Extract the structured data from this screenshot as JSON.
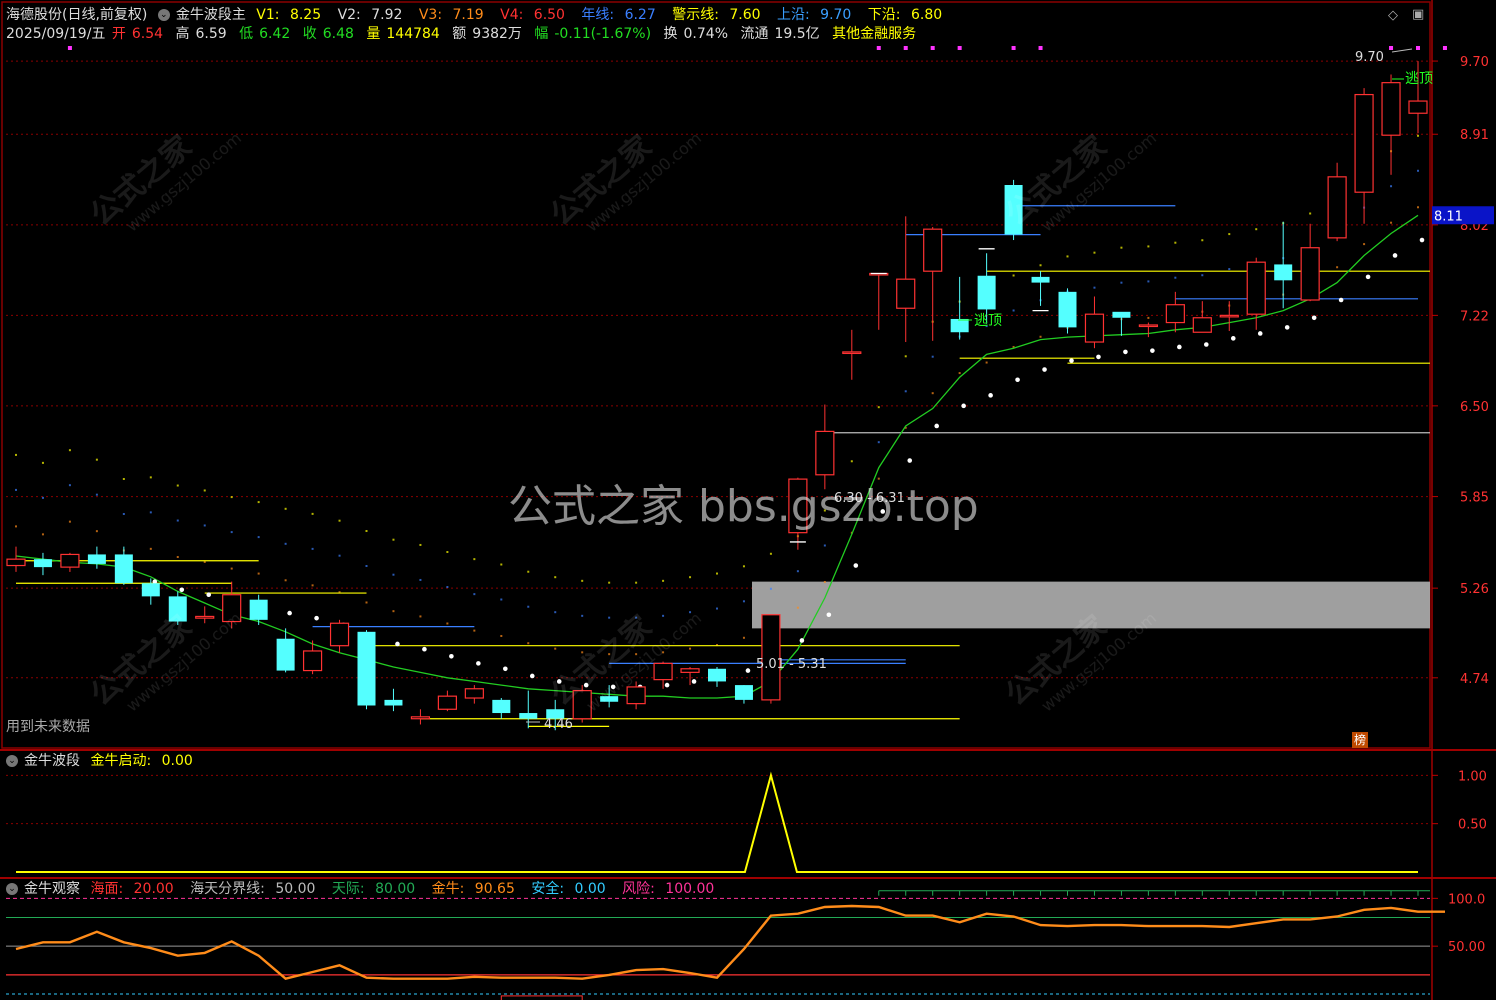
{
  "header": {
    "stock": "海德股份(日线,前复权)",
    "indicator": "金牛波段主",
    "v1_label": "V1:",
    "v1": "8.25",
    "v2_label": "V2:",
    "v2": "7.92",
    "v3_label": "V3:",
    "v3": "7.19",
    "v4_label": "V4:",
    "v4": "6.50",
    "nianxian_label": "年线:",
    "nianxian": "6.27",
    "jingshi_label": "警示线:",
    "jingshi": "7.60",
    "shangyan_label": "上沿:",
    "shangyan": "9.70",
    "xiayan_label": "下沿:",
    "xiayan": "6.80",
    "date": "2025/09/19/五",
    "open_label": "开",
    "open": "6.54",
    "high_label": "高",
    "high": "6.59",
    "low_label": "低",
    "low": "6.42",
    "close_label": "收",
    "close": "6.48",
    "vol_label": "量",
    "vol": "144784",
    "amt_label": "额",
    "amt": "9382万",
    "chg_label": "幅",
    "chg": "-0.11(-1.67%)",
    "turn_label": "换",
    "turn": "0.74%",
    "float_label": "流通",
    "float": "19.5亿",
    "sector": "其他金融服务"
  },
  "labels": {
    "future_data": "用到未来数据",
    "rank_badge": "榜",
    "watermark_center": "公式之家 bbs.gszb.top",
    "watermark_cn": "公式之家",
    "watermark_url": "www.gszj100.com",
    "escape_top": "逃顶",
    "price_mark_top": "9.70",
    "range_upper": "6.30 - 6.31",
    "range_lower": "5.01 - 5.31",
    "low_mark": "4.46",
    "current_price_tag": "8.11"
  },
  "panel2": {
    "title": "金牛波段",
    "item_label": "金牛启动:",
    "item_value": "0.00"
  },
  "panel3": {
    "title": "金牛观察",
    "haimian_label": "海面:",
    "haimian": "20.00",
    "fenjie_label": "海天分界线:",
    "fenjie": "50.00",
    "tianji_label": "天际:",
    "tianji": "80.00",
    "jinniu_label": "金牛:",
    "jinniu": "90.65",
    "anquan_label": "安全:",
    "anquan": "0.00",
    "fengxian_label": "风险:",
    "fengxian": "100.00"
  },
  "colors": {
    "up": "#ff3232",
    "down": "#54ffff",
    "ma": "#22cc22",
    "yellow": "#ffff00",
    "blue": "#3a7fff",
    "orange": "#ff8c1a",
    "magenta": "#ff33ff",
    "grid": "#8b0000"
  },
  "chart_data": [
    {
      "type": "candlestick",
      "price_axis_ticks": [
        9.7,
        8.91,
        8.02,
        7.22,
        6.5,
        5.85,
        5.26,
        4.74
      ],
      "candles": [
        [
          5.4,
          5.52,
          5.36,
          5.44
        ],
        [
          5.44,
          5.48,
          5.34,
          5.39
        ],
        [
          5.39,
          5.48,
          5.36,
          5.47
        ],
        [
          5.47,
          5.52,
          5.38,
          5.41
        ],
        [
          5.47,
          5.52,
          5.28,
          5.29
        ],
        [
          5.29,
          5.32,
          5.16,
          5.21
        ],
        [
          5.21,
          5.24,
          5.04,
          5.06
        ],
        [
          5.08,
          5.15,
          5.05,
          5.09
        ],
        [
          5.06,
          5.3,
          5.02,
          5.22
        ],
        [
          5.19,
          5.22,
          5.04,
          5.07
        ],
        [
          4.96,
          5.02,
          4.77,
          4.78
        ],
        [
          4.78,
          4.95,
          4.76,
          4.89
        ],
        [
          4.92,
          5.07,
          4.88,
          5.05
        ],
        [
          5.0,
          5.01,
          4.57,
          4.59
        ],
        [
          4.62,
          4.68,
          4.56,
          4.59
        ],
        [
          4.52,
          4.57,
          4.49,
          4.53
        ],
        [
          4.57,
          4.67,
          4.56,
          4.64
        ],
        [
          4.63,
          4.7,
          4.6,
          4.68
        ],
        [
          4.62,
          4.63,
          4.52,
          4.55
        ],
        [
          4.55,
          4.67,
          4.47,
          4.52
        ],
        [
          4.57,
          4.62,
          4.46,
          4.52
        ],
        [
          4.52,
          4.7,
          4.5,
          4.67
        ],
        [
          4.64,
          4.7,
          4.58,
          4.61
        ],
        [
          4.6,
          4.72,
          4.57,
          4.69
        ],
        [
          4.73,
          4.83,
          4.68,
          4.82
        ],
        [
          4.77,
          4.8,
          4.7,
          4.79
        ],
        [
          4.79,
          4.8,
          4.69,
          4.72
        ],
        [
          4.7,
          4.7,
          4.6,
          4.62
        ],
        [
          4.62,
          5.1,
          4.6,
          5.1
        ],
        [
          5.61,
          5.98,
          5.5,
          5.97
        ],
        [
          6.0,
          6.51,
          5.9,
          6.31
        ],
        [
          6.92,
          7.1,
          6.7,
          6.92
        ],
        [
          7.58,
          7.58,
          7.1,
          7.58
        ],
        [
          7.28,
          8.1,
          7.0,
          7.53
        ],
        [
          7.6,
          8.0,
          7.01,
          7.98
        ],
        [
          7.19,
          7.55,
          7.02,
          7.08
        ],
        [
          7.56,
          7.76,
          7.15,
          7.27
        ],
        [
          8.4,
          8.45,
          7.88,
          7.93
        ],
        [
          7.55,
          7.6,
          7.3,
          7.5
        ],
        [
          7.42,
          7.45,
          7.07,
          7.12
        ],
        [
          7.0,
          7.38,
          6.95,
          7.23
        ],
        [
          7.25,
          7.22,
          7.05,
          7.2
        ],
        [
          7.14,
          7.16,
          7.04,
          7.14
        ],
        [
          7.16,
          7.42,
          7.08,
          7.31
        ],
        [
          7.08,
          7.34,
          7.08,
          7.2
        ],
        [
          7.21,
          7.34,
          7.09,
          7.22
        ],
        [
          7.23,
          7.72,
          7.1,
          7.68
        ],
        [
          7.66,
          8.05,
          7.28,
          7.52
        ],
        [
          7.35,
          8.03,
          7.34,
          7.81
        ],
        [
          7.9,
          8.62,
          7.87,
          8.48
        ],
        [
          8.33,
          9.4,
          8.03,
          9.33
        ],
        [
          8.9,
          9.55,
          8.5,
          9.46
        ],
        [
          9.13,
          9.7,
          8.92,
          9.26
        ]
      ],
      "ma": [
        5.46,
        5.44,
        5.42,
        5.41,
        5.39,
        5.33,
        5.24,
        5.17,
        5.1,
        5.06,
        5.0,
        4.93,
        4.88,
        4.84,
        4.8,
        4.77,
        4.74,
        4.72,
        4.7,
        4.68,
        4.67,
        4.66,
        4.65,
        4.64,
        4.64,
        4.63,
        4.63,
        4.64,
        4.72,
        4.9,
        5.2,
        5.6,
        6.05,
        6.35,
        6.48,
        6.72,
        6.9,
        6.95,
        7.02,
        7.04,
        7.05,
        7.06,
        7.07,
        7.1,
        7.12,
        7.16,
        7.2,
        7.26,
        7.36,
        7.5,
        7.74,
        7.94,
        8.11
      ],
      "white_dots": [
        null,
        null,
        null,
        null,
        null,
        5.3,
        5.25,
        5.22,
        5.18,
        5.15,
        5.11,
        5.08,
        5.04,
        4.98,
        4.93,
        4.9,
        4.86,
        4.82,
        4.79,
        4.75,
        4.72,
        4.7,
        4.69,
        4.69,
        4.7,
        4.72,
        4.74,
        4.78,
        4.85,
        4.95,
        5.1,
        5.4,
        5.75,
        6.1,
        6.35,
        6.5,
        6.58,
        6.7,
        6.78,
        6.85,
        6.88,
        6.92,
        6.93,
        6.96,
        6.98,
        7.03,
        7.07,
        7.12,
        7.2,
        7.35,
        7.55,
        7.74,
        7.88
      ],
      "zone_gray": [
        5.02,
        5.3
      ],
      "escape_top_price": 7.6,
      "wave_signal": {
        "peak_index": 28,
        "peak": 1.0,
        "ticks": [
          1.0,
          0.5
        ]
      },
      "observe": {
        "values": [
          47,
          54,
          54,
          65,
          54,
          48,
          40,
          43,
          55,
          40,
          16,
          23,
          30,
          17,
          16,
          16,
          16,
          18,
          17,
          17,
          17,
          16,
          20,
          25,
          26,
          22,
          17,
          47,
          82,
          84,
          91,
          92,
          91,
          82,
          82,
          75,
          84,
          81,
          72,
          71,
          72,
          72,
          71,
          71,
          71,
          70,
          74,
          78,
          78,
          81,
          88,
          90,
          86,
          86
        ],
        "levels": {
          "haimian": 20,
          "fenjie": 50,
          "tianji": 80,
          "risk": 100
        },
        "ticks": [
          100.0,
          50.0
        ]
      }
    }
  ]
}
